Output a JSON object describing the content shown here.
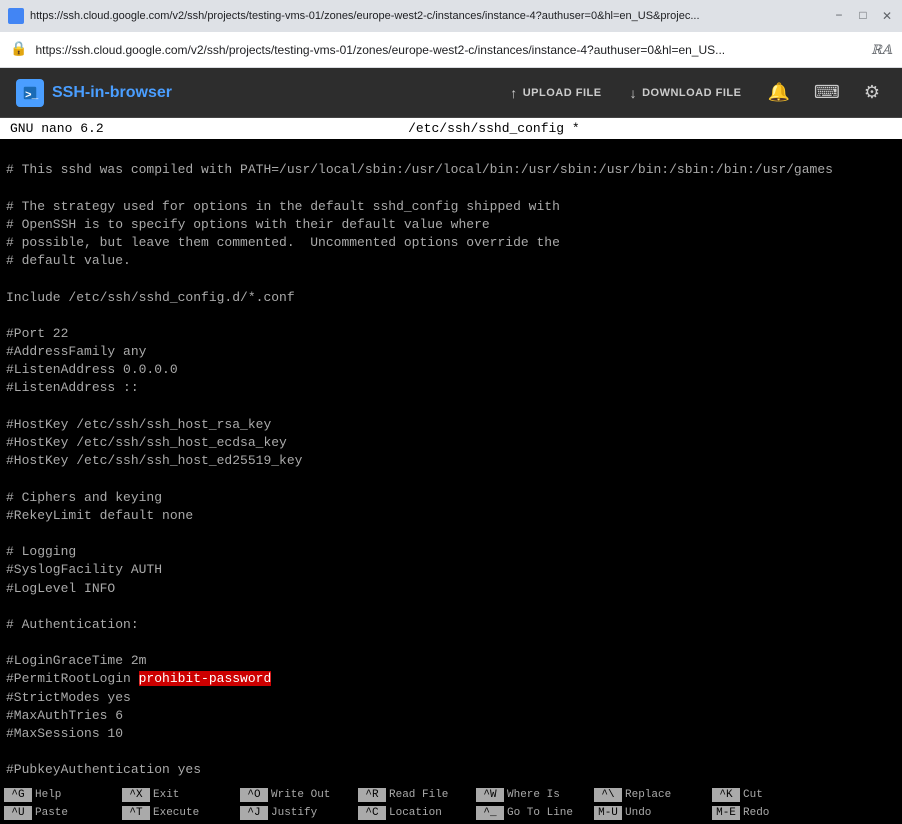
{
  "browser": {
    "title_url": "https://ssh.cloud.google.com/v2/ssh/projects/testing-vms-01/zones/europe-west2-c/instances/instance-4?authuser=0&hl=en_US&projec...",
    "address_url": "https://ssh.cloud.google.com/v2/ssh/projects/testing-vms-01/zones/europe-west2-c/instances/instance-4?authuser=0&hl=en_US...",
    "minimize_label": "−",
    "maximize_label": "□",
    "close_label": "✕"
  },
  "ssh_header": {
    "logo_text_1": "SSH",
    "logo_text_2": "-in-browser",
    "upload_label": "UPLOAD FILE",
    "download_label": "DOWNLOAD FILE"
  },
  "nano": {
    "title_left": "GNU nano 6.2",
    "title_center": "/etc/ssh/sshd_config *",
    "content_lines": [
      "",
      "# This sshd was compiled with PATH=/usr/local/sbin:/usr/local/bin:/usr/sbin:/usr/bin:/sbin:/bin:/usr/games",
      "",
      "# The strategy used for options in the default sshd_config shipped with",
      "# OpenSSH is to specify options with their default value where",
      "# possible, but leave them commented.  Uncommented options override the",
      "# default value.",
      "",
      "Include /etc/ssh/sshd_config.d/*.conf",
      "",
      "#Port 22",
      "#AddressFamily any",
      "#ListenAddress 0.0.0.0",
      "#ListenAddress ::",
      "",
      "#HostKey /etc/ssh/ssh_host_rsa_key",
      "#HostKey /etc/ssh/ssh_host_ecdsa_key",
      "#HostKey /etc/ssh/ssh_host_ed25519_key",
      "",
      "# Ciphers and keying",
      "#RekeyLimit default none",
      "",
      "# Logging",
      "#SyslogFacility AUTH",
      "#LogLevel INFO",
      "",
      "# Authentication:",
      "",
      "#LoginGraceTime 2m",
      "#PermitRootLogin prohibit-password",
      "#StrictModes yes",
      "#MaxAuthTries 6",
      "#MaxSessions 10",
      "",
      "#PubkeyAuthentication yes"
    ],
    "highlighted_line_index": 29,
    "highlighted_text": "#PermitRootLogin prohibit-password",
    "shortcuts": [
      {
        "key": "^G",
        "label": "Help"
      },
      {
        "key": "^X",
        "label": "Exit"
      },
      {
        "key": "^O",
        "label": "Write Out"
      },
      {
        "key": "^R",
        "label": "Read File"
      },
      {
        "key": "^W",
        "label": "Where Is"
      },
      {
        "key": "^\\",
        "label": "Replace"
      },
      {
        "key": "^K",
        "label": "Cut"
      },
      {
        "key": "^U",
        "label": "Paste"
      },
      {
        "key": "^T",
        "label": "Execute"
      },
      {
        "key": "^J",
        "label": "Justify"
      },
      {
        "key": "^C",
        "label": "Location"
      },
      {
        "key": "^_",
        "label": "Go To Line"
      },
      {
        "key": "M-U",
        "label": "Undo"
      },
      {
        "key": "M-E",
        "label": "Redo"
      }
    ]
  }
}
